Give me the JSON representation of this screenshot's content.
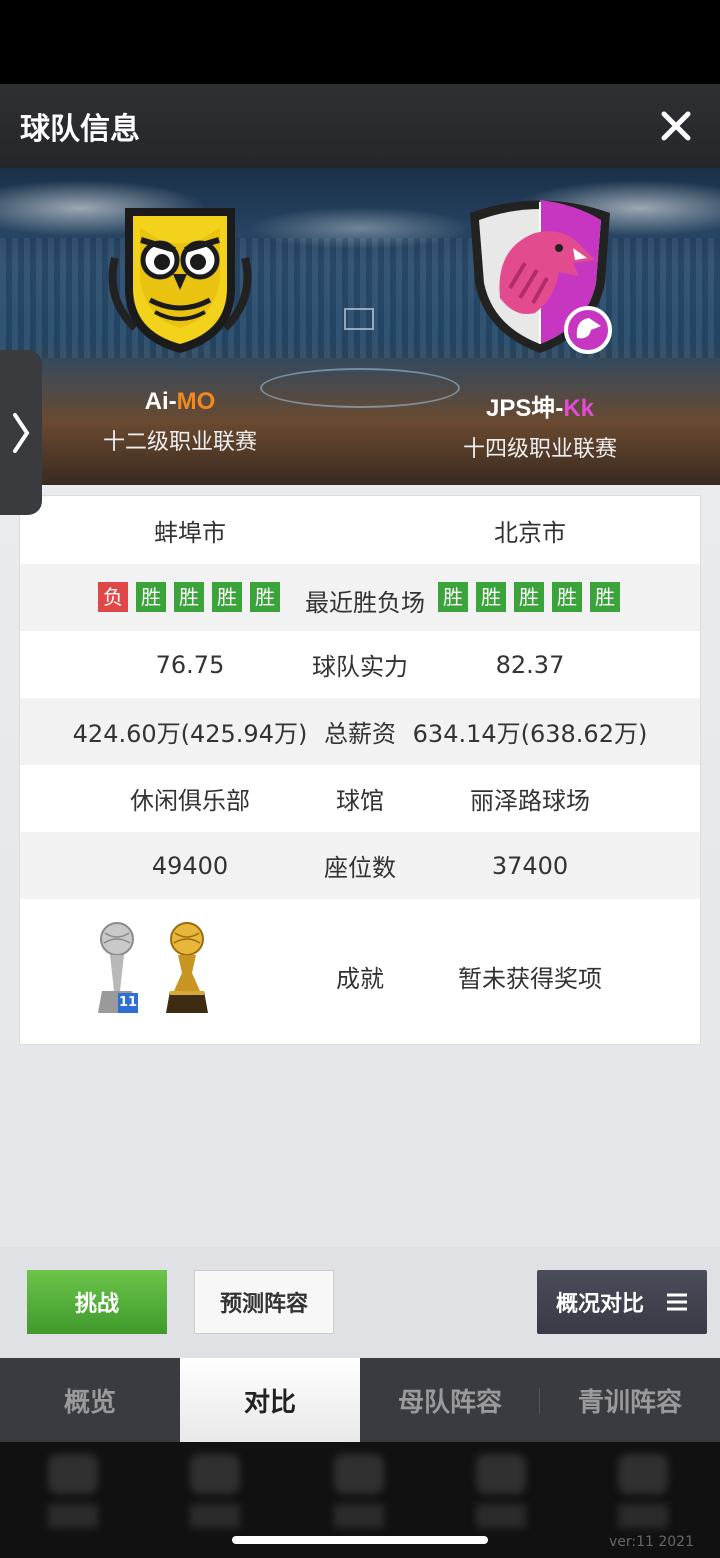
{
  "header": {
    "title": "球队信息",
    "close_icon": "close-icon"
  },
  "home_team": {
    "name_prefix": "Ai-",
    "name_suffix": "MO",
    "league": "十二级职业联赛",
    "city": "蚌埠市",
    "recent_form": [
      "负",
      "胜",
      "胜",
      "胜",
      "胜"
    ],
    "strength": "76.75",
    "salary": "424.60万(425.94万)",
    "venue": "休闲俱乐部",
    "seats": "49400",
    "trophy_count": "11",
    "accent": "#f18a1e"
  },
  "away_team": {
    "name_prefix": "JPS坤-",
    "name_suffix": "Kk",
    "league": "十四级职业联赛",
    "city": "北京市",
    "recent_form": [
      "胜",
      "胜",
      "胜",
      "胜",
      "胜"
    ],
    "strength": "82.37",
    "salary": "634.14万(638.62万)",
    "venue": "丽泽路球场",
    "seats": "37400",
    "achievements": "暂未获得奖项",
    "accent": "#e34bd7"
  },
  "labels": {
    "recent_form": "最近胜负场",
    "strength": "球队实力",
    "salary": "总薪资",
    "venue": "球馆",
    "seats": "座位数",
    "achievements": "成就"
  },
  "actions": {
    "challenge": "挑战",
    "predict_lineup": "预测阵容",
    "compare_overview": "概况对比"
  },
  "tabs": [
    {
      "label": "概览",
      "active": false
    },
    {
      "label": "对比",
      "active": true
    },
    {
      "label": "母队阵容",
      "active": false
    },
    {
      "label": "青训阵容",
      "active": false
    }
  ],
  "footer": {
    "version": "ver:11  2021"
  }
}
